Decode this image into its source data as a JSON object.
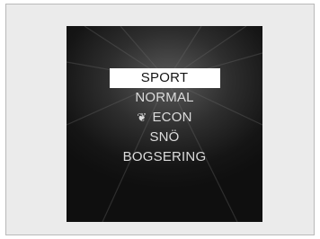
{
  "menu": {
    "items": [
      {
        "label": "SPORT",
        "selected": true
      },
      {
        "label": "NORMAL",
        "selected": false
      },
      {
        "label": "ECON",
        "selected": false,
        "icon": "leaf-icon"
      },
      {
        "label": "SNÖ",
        "selected": false
      },
      {
        "label": "BOGSERING",
        "selected": false
      }
    ]
  },
  "colors": {
    "frame_bg": "#ebebeb",
    "screen_bg": "#151515",
    "text": "#dcdcdc",
    "highlight_bg": "#ffffff",
    "highlight_text": "#141414"
  }
}
